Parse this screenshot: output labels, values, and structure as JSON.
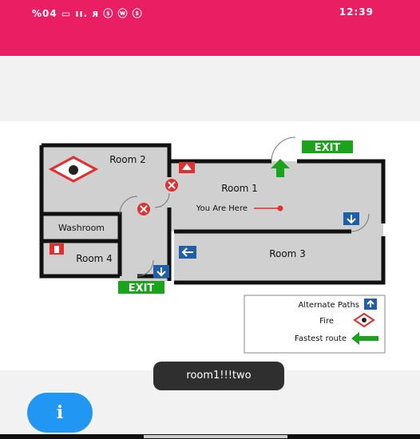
{
  "status_bar": {
    "left_text": "%04 ▭ ıı. ᴙ ⓢ ⓦ ⓢ",
    "time": "12:39"
  },
  "map": {
    "exit_top": "EXIT",
    "exit_bottom": "EXIT",
    "rooms": {
      "room1": "Room 1",
      "room2": "Room 2",
      "room3": "Room 3",
      "room4": "Room 4",
      "washroom": "Washroom"
    },
    "you_are_here": "You Are Here",
    "legend": {
      "alternate": "Alternate Paths",
      "fire": "Fire",
      "fastest": "Fastest route"
    }
  },
  "toast": {
    "text": "room1!!!two"
  },
  "fab": {
    "icon": "info-icon",
    "glyph": "i"
  },
  "colors": {
    "accent": "#e91e63",
    "fab": "#2196f3",
    "exit": "#1ba31b",
    "alt_arrow": "#1f5fa8",
    "danger": "#e03030"
  }
}
